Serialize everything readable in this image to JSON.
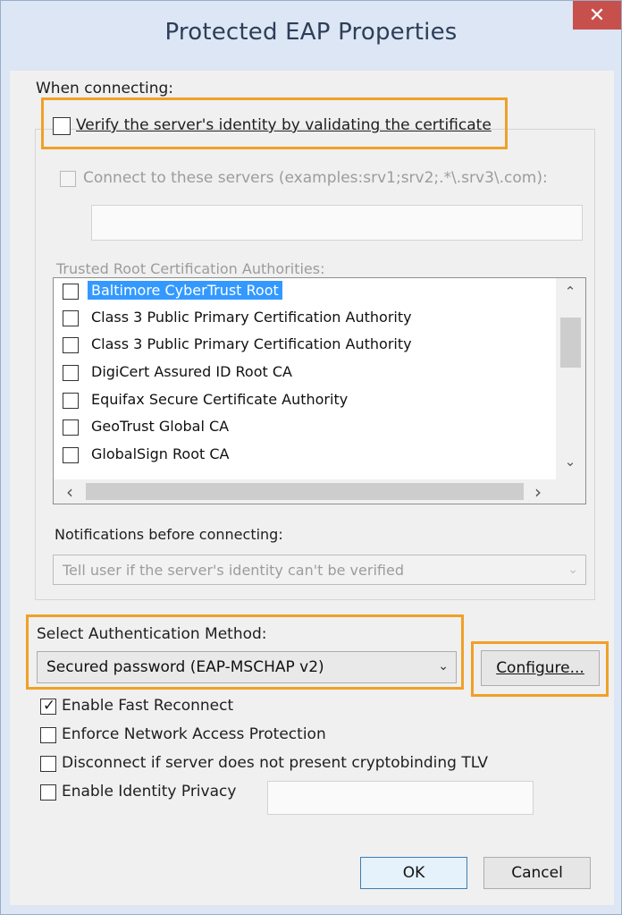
{
  "window": {
    "title": "Protected EAP Properties",
    "close_glyph": "✕"
  },
  "when_connecting": {
    "label": "When connecting:"
  },
  "verify_cert": {
    "label": "Verify the server's identity by validating the certificate",
    "checked": false
  },
  "connect_servers": {
    "label": "Connect to these servers (examples:srv1;srv2;.*\\.srv3\\.com):",
    "value": ""
  },
  "trusted_root": {
    "label": "Trusted Root Certification Authorities:",
    "items": [
      {
        "name": "Baltimore CyberTrust Root",
        "selected": true
      },
      {
        "name": "Class 3 Public Primary Certification Authority"
      },
      {
        "name": "Class 3 Public Primary Certification Authority"
      },
      {
        "name": "DigiCert Assured ID Root CA"
      },
      {
        "name": "Equifax Secure Certificate Authority"
      },
      {
        "name": "GeoTrust Global CA"
      },
      {
        "name": "GlobalSign Root CA"
      }
    ]
  },
  "notifications": {
    "label": "Notifications before connecting:",
    "value": "Tell user if the server's identity can't be verified"
  },
  "auth_method": {
    "label": "Select Authentication Method:",
    "value": "Secured password (EAP-MSCHAP v2)",
    "configure_label": "Configure..."
  },
  "options": {
    "fast_reconnect": {
      "label": "Enable Fast Reconnect",
      "checked": true
    },
    "nap": {
      "label": "Enforce Network Access Protection",
      "checked": false
    },
    "cryptobinding": {
      "label": "Disconnect if server does not present cryptobinding TLV",
      "checked": false
    },
    "identity_privacy": {
      "label": "Enable Identity Privacy",
      "checked": false,
      "value": ""
    }
  },
  "buttons": {
    "ok": "OK",
    "cancel": "Cancel"
  },
  "glyphs": {
    "check": "✓",
    "dropdown": "⌄",
    "up": "⌃",
    "down": "⌄",
    "left": "‹",
    "right": "›"
  },
  "colors": {
    "highlight": "#f0a028",
    "selection": "#3399ff",
    "close": "#c7504d"
  }
}
